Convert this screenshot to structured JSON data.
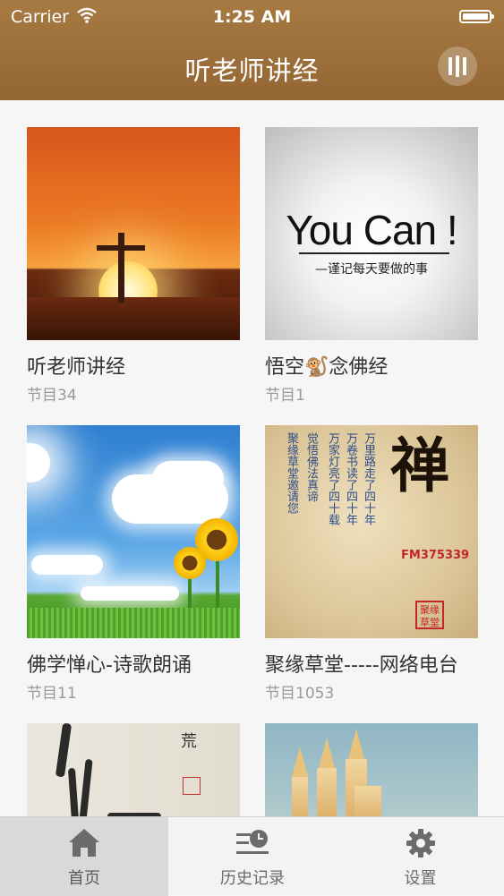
{
  "status_bar": {
    "carrier": "Carrier",
    "time": "1:25 AM"
  },
  "nav": {
    "title": "听老师讲经",
    "player_icon": "audio-bars-icon"
  },
  "programs": [
    {
      "title": "听老师讲经",
      "count": "节目34"
    },
    {
      "title": "悟空🐒念佛经",
      "count": "节目1"
    },
    {
      "title": "佛学惮心-诗歌朗诵",
      "count": "节目11"
    },
    {
      "title": "聚缘草堂-----网络电台",
      "count": "节目1053"
    },
    {
      "title": "",
      "count": ""
    },
    {
      "title": "",
      "count": ""
    }
  ],
  "thumb_text": {
    "youcan_main": "You Can !",
    "youcan_sub": "—谨记每天要做的事",
    "zen_char": "禅",
    "zen_fm": "FM375339",
    "zen_seal": "聚缘草堂",
    "zen_columns": [
      "万里路走了四十年",
      "万卷书读了四十年",
      "万家灯亮了四十载",
      "觉悟佛法真谛",
      "聚缘草堂邀请您"
    ],
    "ink_char": "荒"
  },
  "tabs": [
    {
      "label": "首页",
      "icon": "home-icon",
      "active": true
    },
    {
      "label": "历史记录",
      "icon": "history-icon",
      "active": false
    },
    {
      "label": "设置",
      "icon": "gear-icon",
      "active": false
    }
  ],
  "colors": {
    "header": "#9c6d38",
    "tab_active_bg": "#d9d9d9"
  }
}
